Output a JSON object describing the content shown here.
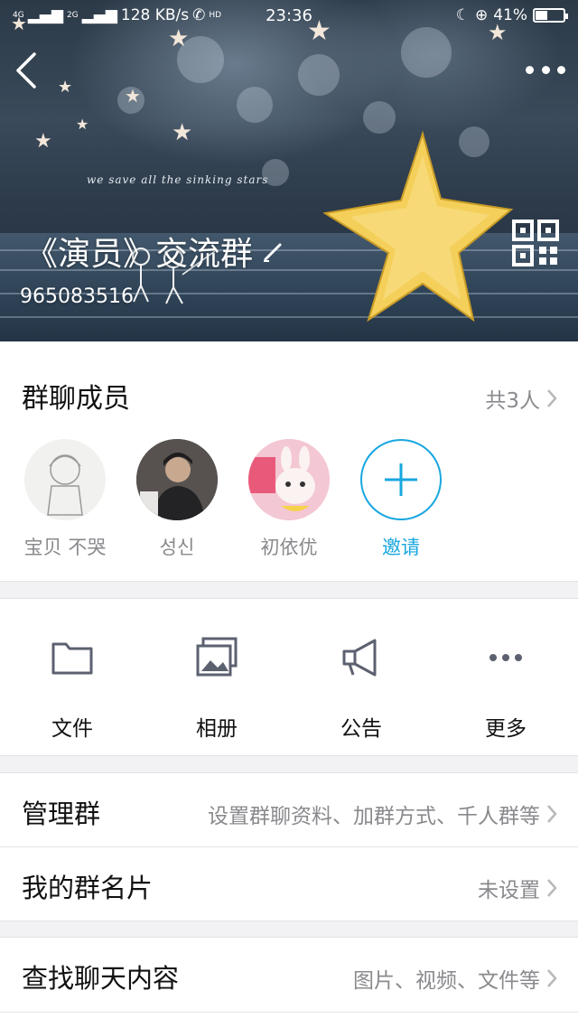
{
  "status_bar": {
    "network": "4G",
    "network2": "2G",
    "speed": "128 KB/s",
    "hd": "HD",
    "time": "23:36",
    "battery": "41%"
  },
  "header": {
    "tagline": "we save all the sinking stars",
    "group_name": "《演员》交流群",
    "group_id": "965083516",
    "icons": [
      "back-icon",
      "more-icon",
      "edit-icon",
      "qr-code-icon"
    ]
  },
  "members": {
    "title": "群聊成员",
    "count": "共3人",
    "items": [
      {
        "name": "宝贝 不哭"
      },
      {
        "name": "성신"
      },
      {
        "name": "初依优"
      }
    ],
    "invite_label": "邀请"
  },
  "actions": [
    {
      "label": "文件",
      "icon": "folder-icon"
    },
    {
      "label": "相册",
      "icon": "album-icon"
    },
    {
      "label": "公告",
      "icon": "megaphone-icon"
    },
    {
      "label": "更多",
      "icon": "more-dots-icon"
    }
  ],
  "settings": {
    "manage": {
      "title": "管理群",
      "value": "设置群聊资料、加群方式、千人群等"
    },
    "card": {
      "title": "我的群名片",
      "value": "未设置"
    },
    "search": {
      "title": "查找聊天内容",
      "value": "图片、视频、文件等"
    }
  },
  "colors": {
    "accent": "#19a7e0",
    "secondary_text": "#8a8a8e",
    "icon_gray": "#5c6170"
  }
}
